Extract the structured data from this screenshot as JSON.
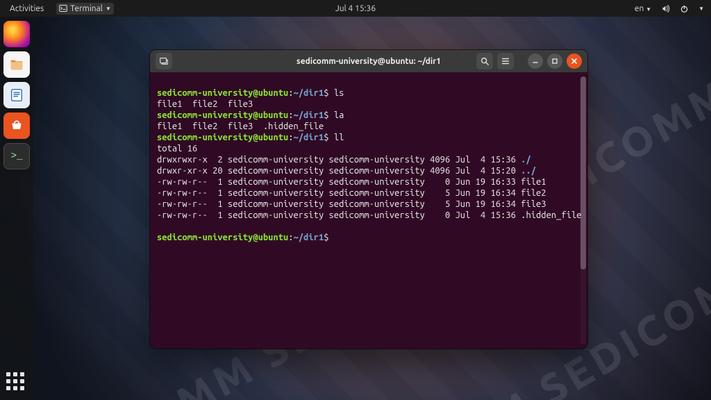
{
  "topbar": {
    "activities": "Activities",
    "terminal_menu": "Terminal",
    "clock": "Jul 4  15:36",
    "lang": "en"
  },
  "dock": {
    "items": [
      {
        "name": "Firefox"
      },
      {
        "name": "Files"
      },
      {
        "name": "LibreOffice Writer"
      },
      {
        "name": "Ubuntu Software"
      },
      {
        "name": "Terminal"
      }
    ],
    "apps_button": "Show Applications"
  },
  "window": {
    "title": "sedicomm-university@ubuntu: ~/dir1"
  },
  "prompt": {
    "user_host": "sedicomm-university@ubuntu",
    "sep": ":",
    "path": "~/dir1",
    "sigil": "$"
  },
  "terminal": {
    "cmd_ls": "ls",
    "out_ls": "file1  file2  file3",
    "cmd_la": "la",
    "out_la": "file1  file2  file3  .hidden_file",
    "cmd_ll": "ll",
    "ll_total": "total 16",
    "ll_rows": [
      {
        "perm": "drwxrwxr-x",
        "links": " 2",
        "owner": "sedicomm-university",
        "group": "sedicomm-university",
        "size": "4096",
        "date": "Jul  4 15:36",
        "name": "./",
        "dir": true
      },
      {
        "perm": "drwxr-xr-x",
        "links": "20",
        "owner": "sedicomm-university",
        "group": "sedicomm-university",
        "size": "4096",
        "date": "Jul  4 15:20",
        "name": "../",
        "dir": true
      },
      {
        "perm": "-rw-rw-r--",
        "links": " 1",
        "owner": "sedicomm-university",
        "group": "sedicomm-university",
        "size": "   0",
        "date": "Jun 19 16:33",
        "name": "file1",
        "dir": false
      },
      {
        "perm": "-rw-rw-r--",
        "links": " 1",
        "owner": "sedicomm-university",
        "group": "sedicomm-university",
        "size": "   5",
        "date": "Jun 19 16:34",
        "name": "file2",
        "dir": false
      },
      {
        "perm": "-rw-rw-r--",
        "links": " 1",
        "owner": "sedicomm-university",
        "group": "sedicomm-university",
        "size": "   5",
        "date": "Jun 19 16:34",
        "name": "file3",
        "dir": false
      },
      {
        "perm": "-rw-rw-r--",
        "links": " 1",
        "owner": "sedicomm-university",
        "group": "sedicomm-university",
        "size": "   0",
        "date": "Jul  4 15:36",
        "name": ".hidden_file",
        "dir": false
      }
    ]
  },
  "colors": {
    "accent": "#e95420",
    "term_bg": "#300a24"
  }
}
